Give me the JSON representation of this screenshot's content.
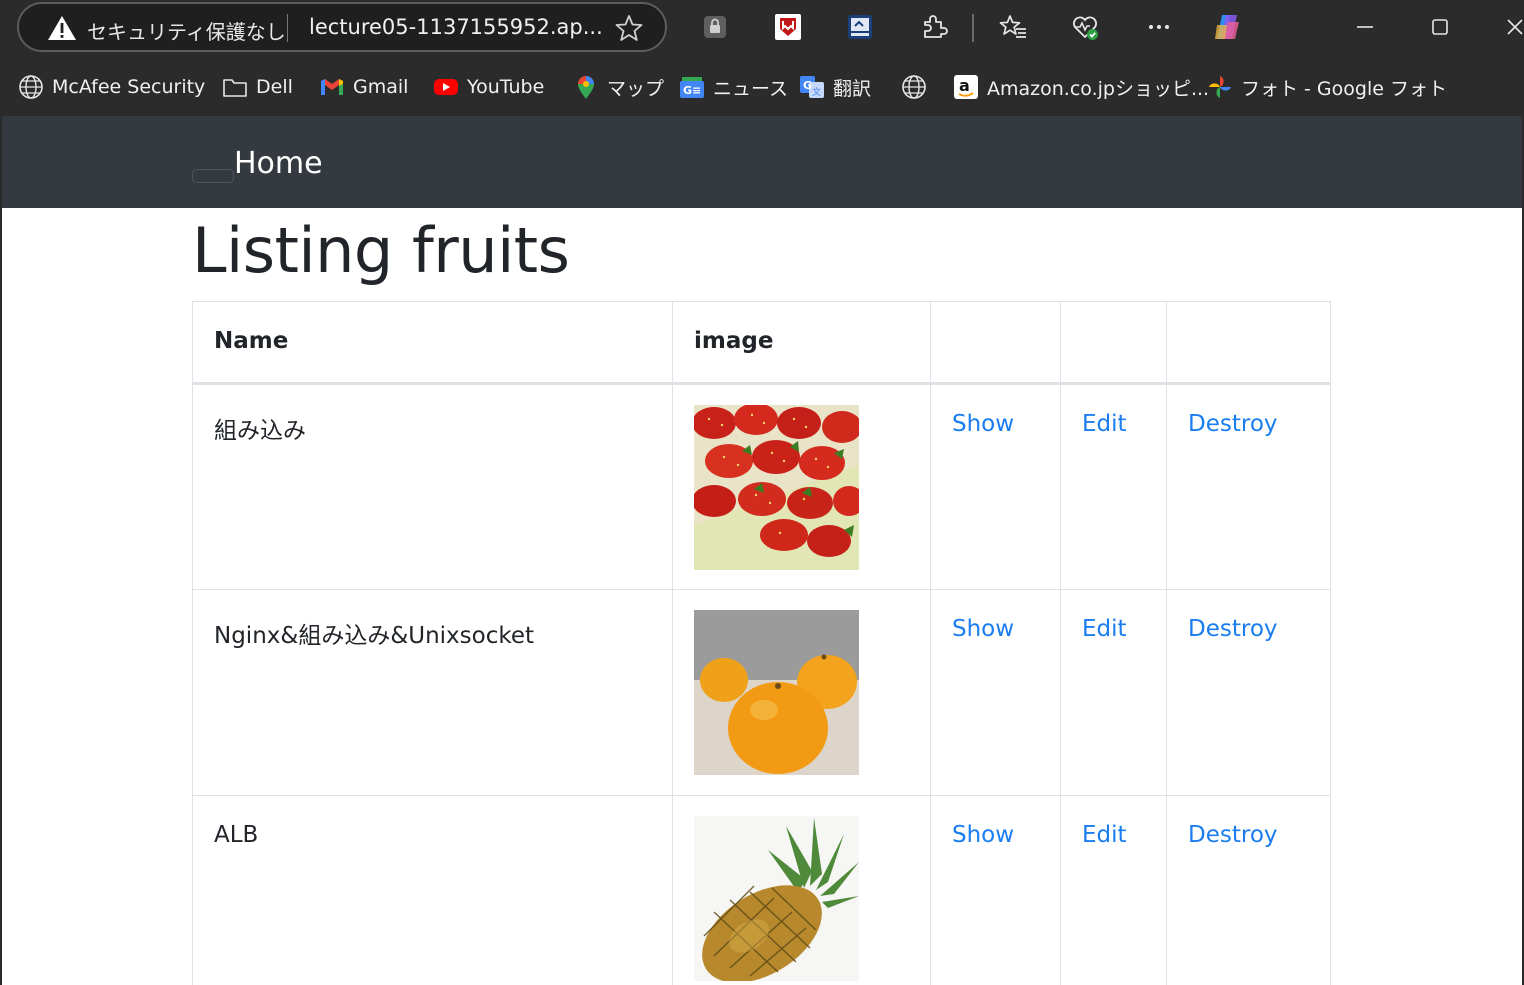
{
  "browser": {
    "security_label": "セキュリティ保護なし",
    "url": "lecture05-1137155952.ap...",
    "bookmarks": [
      {
        "label": "McAfee Security",
        "icon": "globe-icon"
      },
      {
        "label": "Dell",
        "icon": "folder-icon"
      },
      {
        "label": "Gmail",
        "icon": "gmail-icon"
      },
      {
        "label": "YouTube",
        "icon": "youtube-icon"
      },
      {
        "label": "マップ",
        "icon": "maps-pin-icon"
      },
      {
        "label": "ニュース",
        "icon": "news-icon"
      },
      {
        "label": "翻訳",
        "icon": "translate-icon"
      },
      {
        "label": "",
        "icon": "globe-icon"
      },
      {
        "label": "Amazon.co.jpショッピ...",
        "icon": "amazon-icon"
      },
      {
        "label": "フォト - Google フォト",
        "icon": "photos-pinwheel-icon"
      }
    ]
  },
  "navbar": {
    "brand": "Home"
  },
  "page": {
    "title": "Listing fruits"
  },
  "table": {
    "headers": [
      "Name",
      "image",
      "",
      "",
      ""
    ],
    "rows": [
      {
        "name": "組み込み",
        "image": "strawberries-image",
        "show": "Show",
        "edit": "Edit",
        "destroy": "Destroy"
      },
      {
        "name": "Nginx&組み込み&Unixsocket",
        "image": "mandarin-oranges-image",
        "show": "Show",
        "edit": "Edit",
        "destroy": "Destroy"
      },
      {
        "name": "ALB",
        "image": "pineapple-image",
        "show": "Show",
        "edit": "Edit",
        "destroy": "Destroy"
      }
    ]
  },
  "colors": {
    "navbar": "#343a40",
    "link": "#1a7df0",
    "chrome": "#2b2b2b"
  }
}
